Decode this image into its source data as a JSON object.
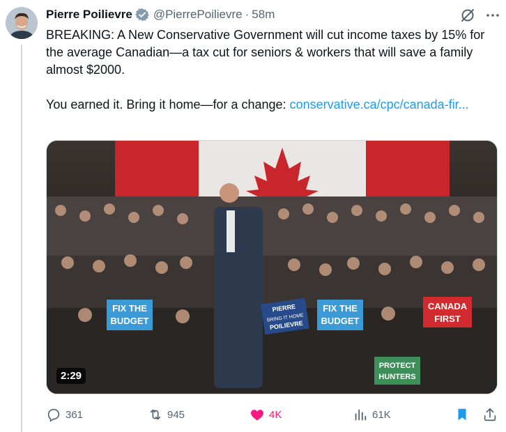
{
  "author": {
    "name": "Pierre Poilievre",
    "handle": "@PierrePoilievre",
    "separator": "·",
    "time": "58m",
    "verified_icon": "verified-badge-icon"
  },
  "tweet": {
    "line1": "BREAKING: A New Conservative Government will cut income taxes by 15% for the average Canadian—a tax cut for seniors & workers that will save a family almost $2000.",
    "line2_prefix": "You earned it. Bring it home—for a change: ",
    "link_text": "conservative.ca/cpc/canada-fir..."
  },
  "media": {
    "duration": "2:29",
    "signs": {
      "fix_budget_line1": "FIX THE",
      "fix_budget_line2": "BUDGET",
      "canada_first_line1": "CANADA",
      "canada_first_line2": "FIRST",
      "protect_hunters_line1": "PROTECT",
      "protect_hunters_line2": "HUNTERS",
      "pierre_line1": "PIERRE",
      "pierre_line2": "BRING IT HOME",
      "pierre_line3": "POILIEVRE"
    }
  },
  "actions": {
    "replies": "361",
    "reposts": "945",
    "likes": "4K",
    "views": "61K"
  },
  "colors": {
    "accent": "#1d9bf0",
    "like": "#f91880",
    "muted": "#536471"
  }
}
